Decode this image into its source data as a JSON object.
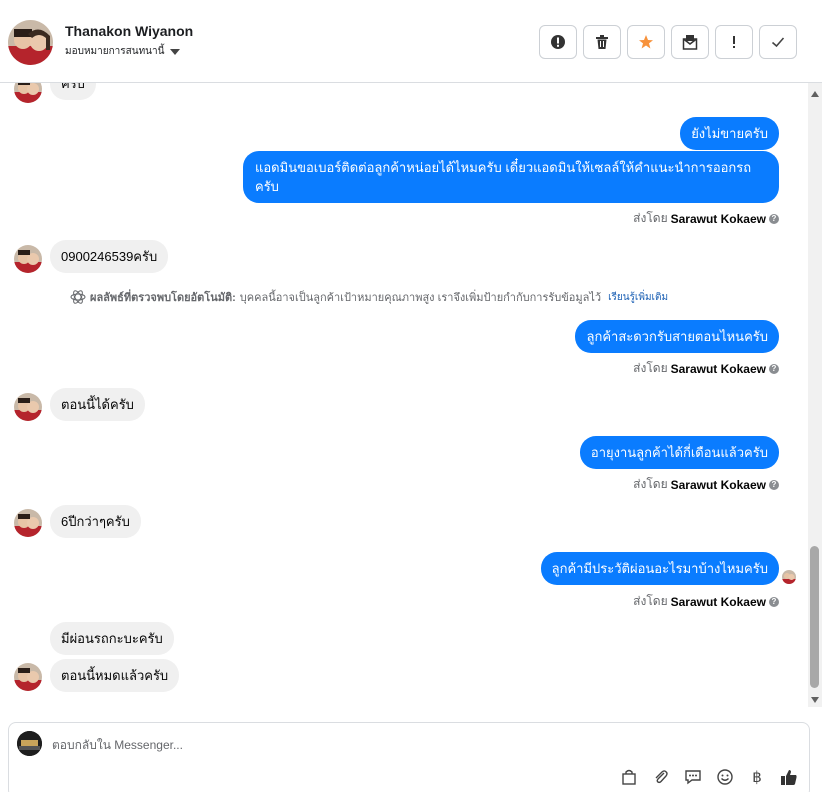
{
  "header": {
    "customer_name": "Thanakon Wiyanon",
    "assign_label": "มอบหมายการสนทนานี้",
    "actions": [
      "spam-icon",
      "trash-icon",
      "star-icon",
      "mark-unread-icon",
      "flag-icon",
      "done-icon"
    ]
  },
  "messages": [
    {
      "dir": "in",
      "text": "ครับ"
    },
    {
      "dir": "out",
      "text": "ยังไม่ขายครับ"
    },
    {
      "dir": "out",
      "text": "แอดมินขอเบอร์ติดต่อลูกค้าหน่อยได้ไหมครับ เดี๋ยวแอดมินให้เซลล์ให้คำแนะนำการออกรถครับ"
    },
    {
      "dir": "in",
      "text": "0900246539ครับ"
    },
    {
      "dir": "out",
      "text": "ลูกค้าสะดวกรับสายตอนไหนครับ"
    },
    {
      "dir": "in",
      "text": "ตอนนี้ได้ครับ"
    },
    {
      "dir": "out",
      "text": "อายุงานลูกค้าได้กี่เดือนแล้วครับ"
    },
    {
      "dir": "in",
      "text": "6ปีกว่าๆครับ"
    },
    {
      "dir": "out",
      "text": "ลูกค้ามีประวัติผ่อนอะไรมาบ้างไหมครับ"
    },
    {
      "dir": "in",
      "text": "มีผ่อนรถกะบะครับ"
    },
    {
      "dir": "in",
      "text": "ตอนนี้หมดแล้วครับ"
    }
  ],
  "sent_by_prefix": "ส่งโดย",
  "sent_by_name": "Sarawut Kokaew",
  "detection": {
    "title": "ผลลัพธ์ที่ตรวจพบโดยอัตโนมัติ:",
    "text": "บุคคลนี้อาจเป็นลูกค้าเป้าหมายคุณภาพสูง เราจึงเพิ่มป้ายกำกับการรับข้อมูลไว้",
    "link": "เรียนรู้เพิ่มเติม"
  },
  "composer": {
    "placeholder": "ตอบกลับใน Messenger...",
    "value": "",
    "tools": [
      "bag-icon",
      "attach-icon",
      "saved-reply-icon",
      "emoji-icon",
      "baht-icon",
      "like-icon"
    ]
  },
  "colors": {
    "outgoing": "#0a7cff",
    "incoming": "#f0f0f0",
    "star": "#f7923b"
  }
}
